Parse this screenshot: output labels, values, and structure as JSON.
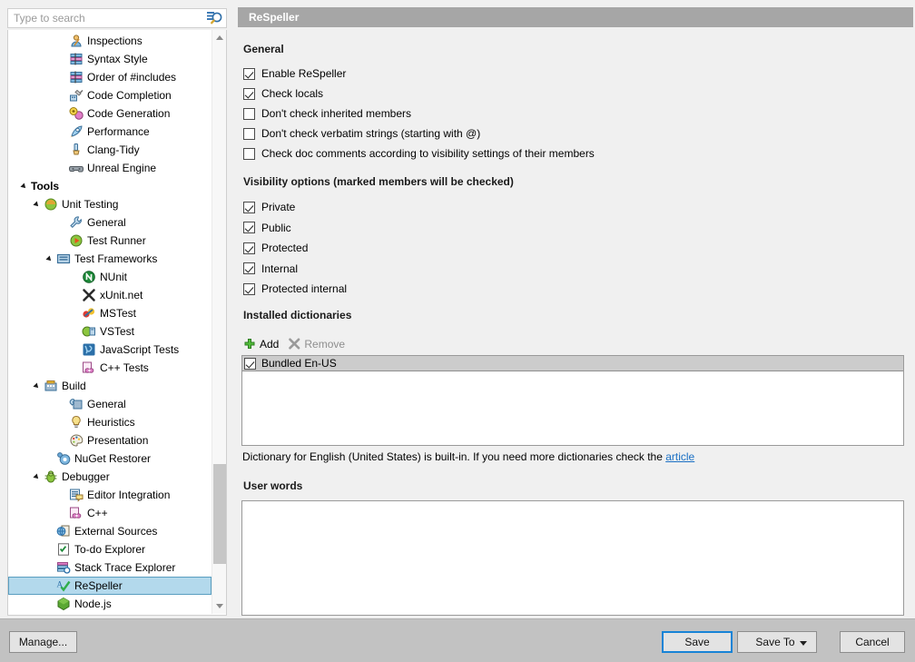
{
  "search": {
    "placeholder": "Type to search",
    "icon": "search-icon"
  },
  "sidebar": {
    "items": [
      {
        "label": "Inspections",
        "indent": 3,
        "icon": "inspections-icon",
        "expander": "none",
        "selected": false,
        "bold": false
      },
      {
        "label": "Syntax Style",
        "indent": 3,
        "icon": "syntax-style-icon",
        "expander": "none",
        "selected": false,
        "bold": false
      },
      {
        "label": "Order of #includes",
        "indent": 3,
        "icon": "order-includes-icon",
        "expander": "none",
        "selected": false,
        "bold": false
      },
      {
        "label": "Code Completion",
        "indent": 3,
        "icon": "code-completion-icon",
        "expander": "none",
        "selected": false,
        "bold": false
      },
      {
        "label": "Code Generation",
        "indent": 3,
        "icon": "code-generation-icon",
        "expander": "none",
        "selected": false,
        "bold": false
      },
      {
        "label": "Performance",
        "indent": 3,
        "icon": "performance-icon",
        "expander": "none",
        "selected": false,
        "bold": false
      },
      {
        "label": "Clang-Tidy",
        "indent": 3,
        "icon": "clang-tidy-icon",
        "expander": "none",
        "selected": false,
        "bold": false
      },
      {
        "label": "Unreal Engine",
        "indent": 3,
        "icon": "unreal-engine-icon",
        "expander": "none",
        "selected": false,
        "bold": false
      },
      {
        "label": "Tools",
        "indent": 0,
        "icon": "none",
        "expander": "open",
        "selected": false,
        "bold": true
      },
      {
        "label": "Unit Testing",
        "indent": 1,
        "icon": "unit-testing-icon",
        "expander": "open",
        "selected": false,
        "bold": false
      },
      {
        "label": "General",
        "indent": 3,
        "icon": "wrench-icon",
        "expander": "none",
        "selected": false,
        "bold": false
      },
      {
        "label": "Test Runner",
        "indent": 3,
        "icon": "test-runner-icon",
        "expander": "none",
        "selected": false,
        "bold": false
      },
      {
        "label": "Test Frameworks",
        "indent": 2,
        "icon": "test-frameworks-icon",
        "expander": "open",
        "selected": false,
        "bold": false
      },
      {
        "label": "NUnit",
        "indent": 4,
        "icon": "nunit-icon",
        "expander": "none",
        "selected": false,
        "bold": false
      },
      {
        "label": "xUnit.net",
        "indent": 4,
        "icon": "xunit-icon",
        "expander": "none",
        "selected": false,
        "bold": false
      },
      {
        "label": "MSTest",
        "indent": 4,
        "icon": "mstest-icon",
        "expander": "none",
        "selected": false,
        "bold": false
      },
      {
        "label": "VSTest",
        "indent": 4,
        "icon": "vstest-icon",
        "expander": "none",
        "selected": false,
        "bold": false
      },
      {
        "label": "JavaScript Tests",
        "indent": 4,
        "icon": "javascript-icon",
        "expander": "none",
        "selected": false,
        "bold": false
      },
      {
        "label": "C++ Tests",
        "indent": 4,
        "icon": "cpp-icon",
        "expander": "none",
        "selected": false,
        "bold": false
      },
      {
        "label": "Build",
        "indent": 1,
        "icon": "build-icon",
        "expander": "open",
        "selected": false,
        "bold": false
      },
      {
        "label": "General",
        "indent": 3,
        "icon": "build-general-icon",
        "expander": "none",
        "selected": false,
        "bold": false
      },
      {
        "label": "Heuristics",
        "indent": 3,
        "icon": "bulb-icon",
        "expander": "none",
        "selected": false,
        "bold": false
      },
      {
        "label": "Presentation",
        "indent": 3,
        "icon": "palette-icon",
        "expander": "none",
        "selected": false,
        "bold": false
      },
      {
        "label": "NuGet Restorer",
        "indent": 2,
        "icon": "nuget-icon",
        "expander": "none",
        "selected": false,
        "bold": false
      },
      {
        "label": "Debugger",
        "indent": 1,
        "icon": "debugger-icon",
        "expander": "open",
        "selected": false,
        "bold": false
      },
      {
        "label": "Editor Integration",
        "indent": 3,
        "icon": "editor-integration-icon",
        "expander": "none",
        "selected": false,
        "bold": false
      },
      {
        "label": "C++",
        "indent": 3,
        "icon": "cpp-icon",
        "expander": "none",
        "selected": false,
        "bold": false
      },
      {
        "label": "External Sources",
        "indent": 2,
        "icon": "external-sources-icon",
        "expander": "none",
        "selected": false,
        "bold": false
      },
      {
        "label": "To-do Explorer",
        "indent": 2,
        "icon": "todo-explorer-icon",
        "expander": "none",
        "selected": false,
        "bold": false
      },
      {
        "label": "Stack Trace Explorer",
        "indent": 2,
        "icon": "stack-trace-icon",
        "expander": "none",
        "selected": false,
        "bold": false
      },
      {
        "label": "ReSpeller",
        "indent": 2,
        "icon": "respeller-icon",
        "expander": "none",
        "selected": true,
        "bold": false
      },
      {
        "label": "Node.js",
        "indent": 2,
        "icon": "nodejs-icon",
        "expander": "none",
        "selected": false,
        "bold": false
      }
    ],
    "scroll_up_icon": "chevron-up-icon",
    "scroll_down_icon": "chevron-down-icon"
  },
  "panel": {
    "title": "ReSpeller",
    "title_bg": "#a6a6a6",
    "sections": {
      "general": "General",
      "visibility": "Visibility options (marked members will be checked)",
      "dictionaries": "Installed dictionaries",
      "user_words": "User words"
    },
    "general_options": [
      {
        "label": "Enable ReSpeller",
        "checked": true
      },
      {
        "label": "Check locals",
        "checked": true
      },
      {
        "label": "Don't check inherited members",
        "checked": false
      },
      {
        "label": "Don't check verbatim strings (starting with @)",
        "checked": false
      },
      {
        "label": "Check doc comments according to visibility settings of their members",
        "checked": false
      }
    ],
    "visibility_options": [
      {
        "label": "Private",
        "checked": true
      },
      {
        "label": "Public",
        "checked": true
      },
      {
        "label": "Protected",
        "checked": true
      },
      {
        "label": "Internal",
        "checked": true
      },
      {
        "label": "Protected internal",
        "checked": true
      }
    ],
    "dict_toolbar": {
      "add_label": "Add",
      "add_icon": "plus-icon",
      "remove_label": "Remove",
      "remove_icon": "remove-x-icon"
    },
    "dictionaries": [
      {
        "label": "Bundled En-US",
        "checked": true,
        "selected": true
      }
    ],
    "dict_note": {
      "text": "Dictionary for English (United States) is built-in. If you need more dictionaries check the ",
      "link": "article",
      "link_color": "#1a6fc4"
    },
    "user_words_value": ""
  },
  "bottom_bar": {
    "manage": "Manage...",
    "save": "Save",
    "save_to": "Save To",
    "cancel": "Cancel",
    "focus_color": "#1783d6"
  }
}
